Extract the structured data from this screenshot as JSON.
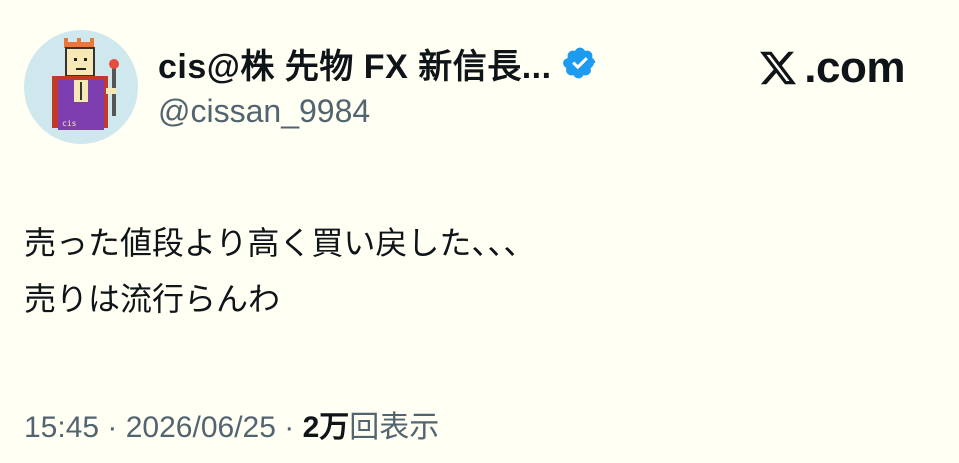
{
  "author": {
    "display_name": "cis@株 先物 FX 新信長...",
    "handle": "@cissan_9984",
    "verified_color": "#1d9bf0",
    "avatar_icon": "pixel-art-king-avatar"
  },
  "brand": {
    "logo_icon": "x-logo-icon",
    "text": ".com"
  },
  "tweet": {
    "lines": [
      "売った値段より高く買い戻した、、、",
      "売りは流行らんわ"
    ]
  },
  "meta": {
    "time": "15:45",
    "separator": " · ",
    "date": "2026/06/25",
    "views_count": "2万",
    "views_label": "回表示"
  },
  "colors": {
    "background": "#fffff3",
    "text": "#0f1419",
    "secondary_text": "#536471",
    "avatar_bg": "#cfe8ee"
  }
}
